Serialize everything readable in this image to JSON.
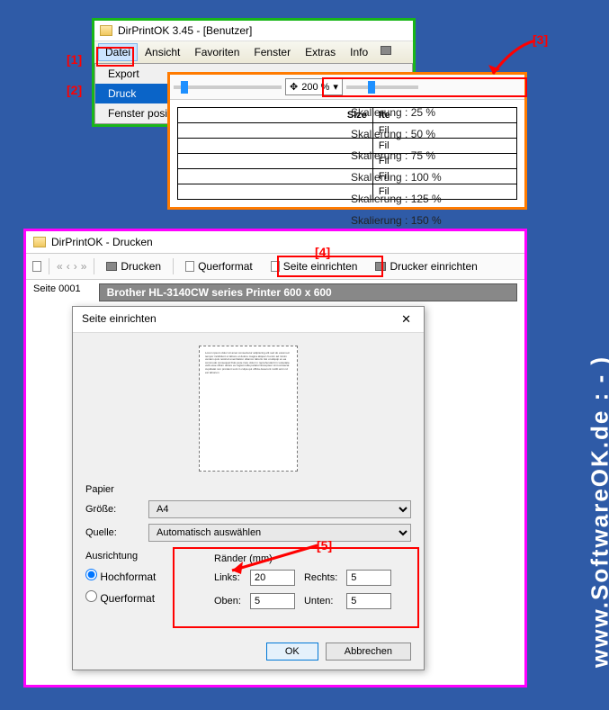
{
  "watermark": "www.SoftwareOK.de  : - )",
  "annotations": [
    "[1]",
    "[2]",
    "[3]",
    "[4]",
    "[5]"
  ],
  "win1": {
    "title": "DirPrintOK 3.45 - [Benutzer]",
    "menus": [
      "Datei",
      "Ansicht",
      "Favoriten",
      "Fenster",
      "Extras",
      "Info"
    ],
    "dropdown": [
      "Export",
      "Druck",
      "Fenster positionieren"
    ]
  },
  "win2": {
    "zoom_value": "200 %",
    "zoom_options": [
      "Skalierung :  25 %",
      "Skalierung :  50 %",
      "Skalierung :  75 %",
      "Skalierung :  100 %",
      "Skalierung :  125 %",
      "Skalierung :  150 %",
      "Skalierung"
    ],
    "table": {
      "headers": [
        "Size",
        "Ite"
      ],
      "rows": [
        "Fil",
        "Fil",
        "Fil",
        "Fil",
        "Fil"
      ]
    }
  },
  "win3": {
    "title": "DirPrintOK - Drucken",
    "toolbar": {
      "print": "Drucken",
      "landscape": "Querformat",
      "page_setup": "Seite einrichten",
      "printer_setup": "Drucker einrichten"
    },
    "page_label": "Seite 0001",
    "printer_info": "Brother HL-3140CW series Printer 600 x 600"
  },
  "dlg": {
    "title": "Seite einrichten",
    "paper_label": "Papier",
    "size_label": "Größe:",
    "size_value": "A4",
    "source_label": "Quelle:",
    "source_value": "Automatisch auswählen",
    "orient_label": "Ausrichtung",
    "orient_portrait": "Hochformat",
    "orient_landscape": "Querformat",
    "margins_label": "Ränder (mm)",
    "margin_left_label": "Links:",
    "margin_left": "20",
    "margin_right_label": "Rechts:",
    "margin_right": "5",
    "margin_top_label": "Oben:",
    "margin_top": "5",
    "margin_bottom_label": "Unten:",
    "margin_bottom": "5",
    "ok": "OK",
    "cancel": "Abbrechen"
  }
}
